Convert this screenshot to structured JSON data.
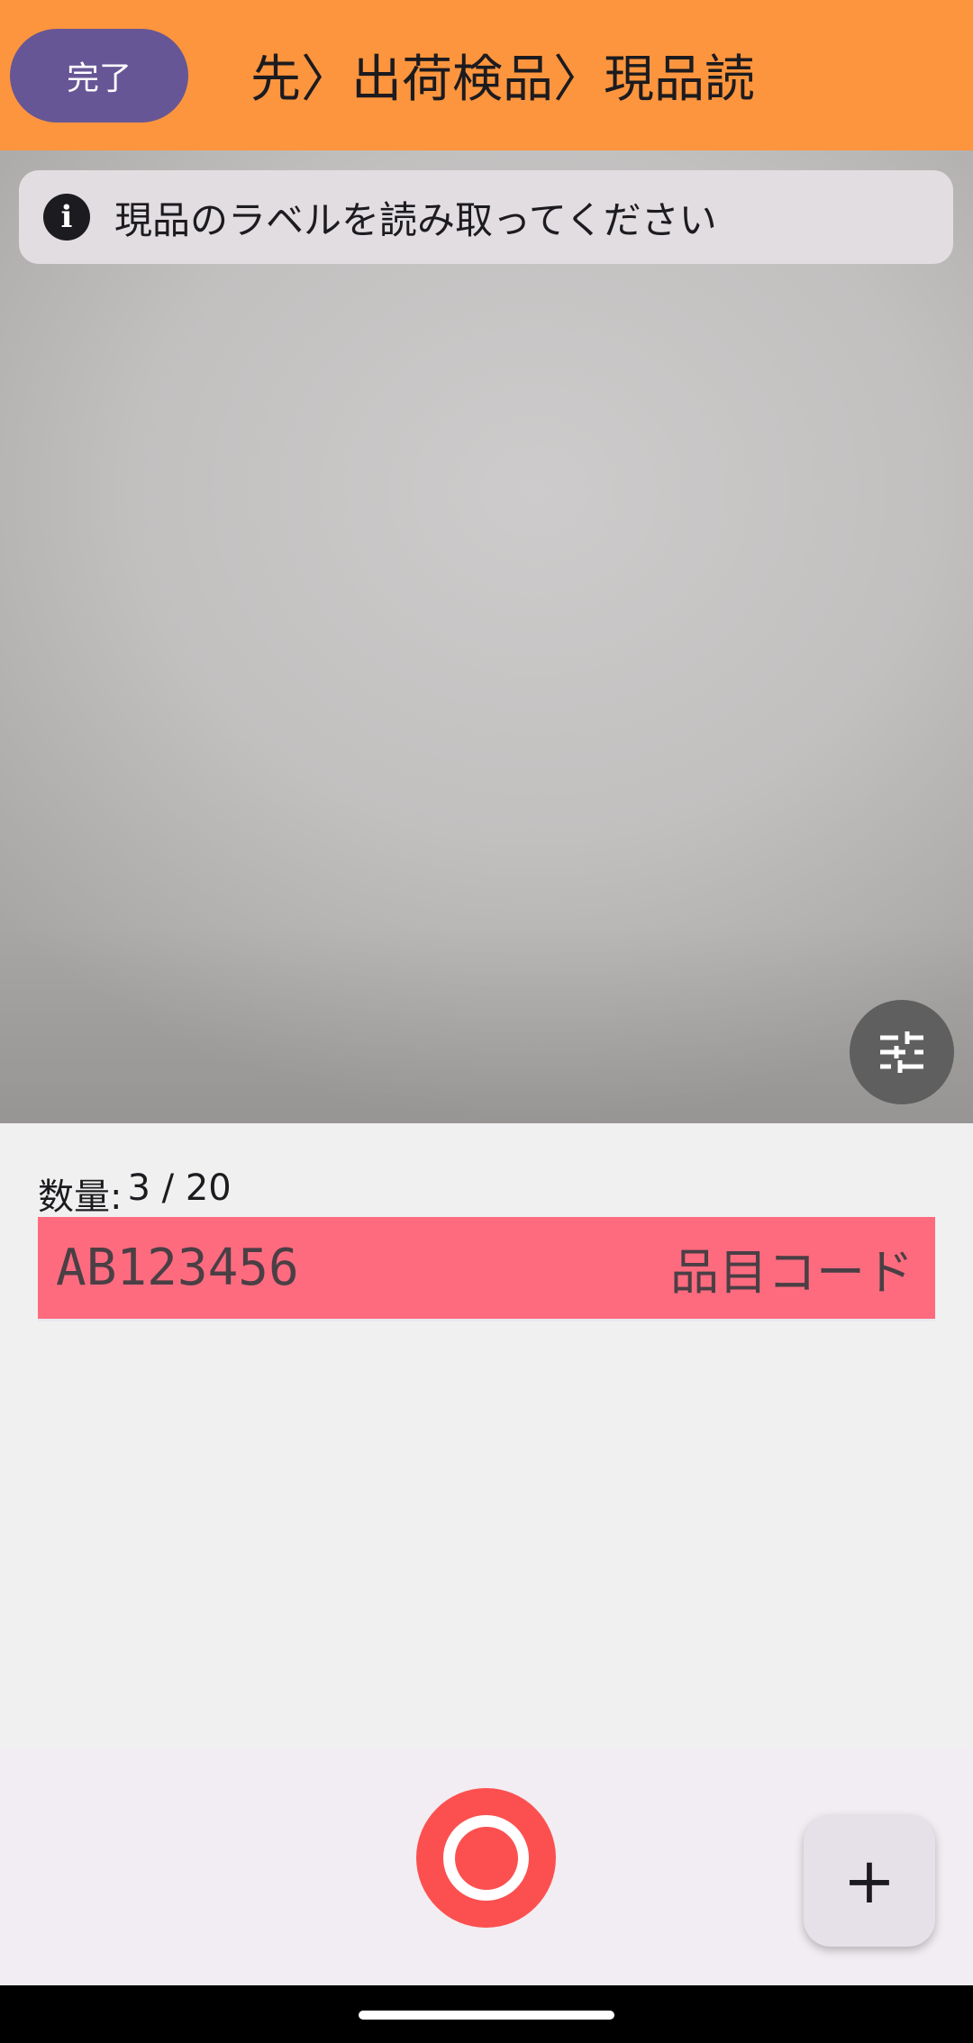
{
  "header": {
    "done_label": "完了",
    "breadcrumb": "先〉出荷検品〉現品読"
  },
  "camera": {
    "hint_text": "現品のラベルを読み取ってください",
    "info_icon_glyph": "i"
  },
  "quantity": {
    "label": "数量:",
    "value": "3 / 20"
  },
  "item_code": {
    "value": "AB123456",
    "label": "品目コード"
  },
  "actions": {
    "fab_glyph": "+"
  },
  "colors": {
    "header_bg": "#fd953e",
    "done_button_bg": "#675696",
    "code_row_bg": "#fe6b7f",
    "shutter": "#fc5050"
  },
  "icons": {
    "info": "info-icon",
    "settings": "tune-sliders-icon",
    "shutter": "shutter-icon",
    "add": "plus-icon"
  }
}
